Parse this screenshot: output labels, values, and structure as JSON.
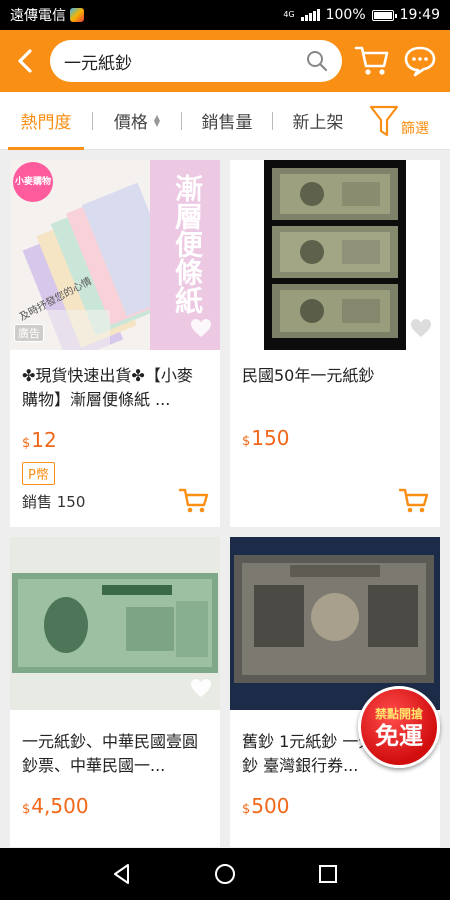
{
  "status": {
    "carrier": "遠傳電信",
    "network": "4G",
    "battery": "100%",
    "time": "19:49"
  },
  "search": {
    "query": "一元紙鈔"
  },
  "sort_tabs": [
    "熱門度",
    "價格",
    "銷售量",
    "新上架"
  ],
  "filter_label": "篩選",
  "products": [
    {
      "title": "✤現貨快速出貨✤【小麥購物】漸層便條紙 ...",
      "currency": "$",
      "price": "12",
      "badge": "P幣",
      "sold": "銷售 150",
      "ad": "廣告",
      "image_text": "漸層便條紙",
      "shop_logo": "小麥購物",
      "image_caption": "及時抒發您的心情"
    },
    {
      "title": "民國50年一元紙鈔",
      "currency": "$",
      "price": "150"
    },
    {
      "title": "一元紙鈔、中華民國壹圓鈔票、中華民國一...",
      "currency": "$",
      "price": "4,500"
    },
    {
      "title": "舊鈔 1元紙鈔 一元 壹圓紙鈔 臺灣銀行券...",
      "currency": "$",
      "price": "500"
    }
  ],
  "promo": {
    "line1": "禁點開搶",
    "line2": "免運"
  },
  "colors": {
    "brand": "#f98f15",
    "price": "#f0681a"
  }
}
